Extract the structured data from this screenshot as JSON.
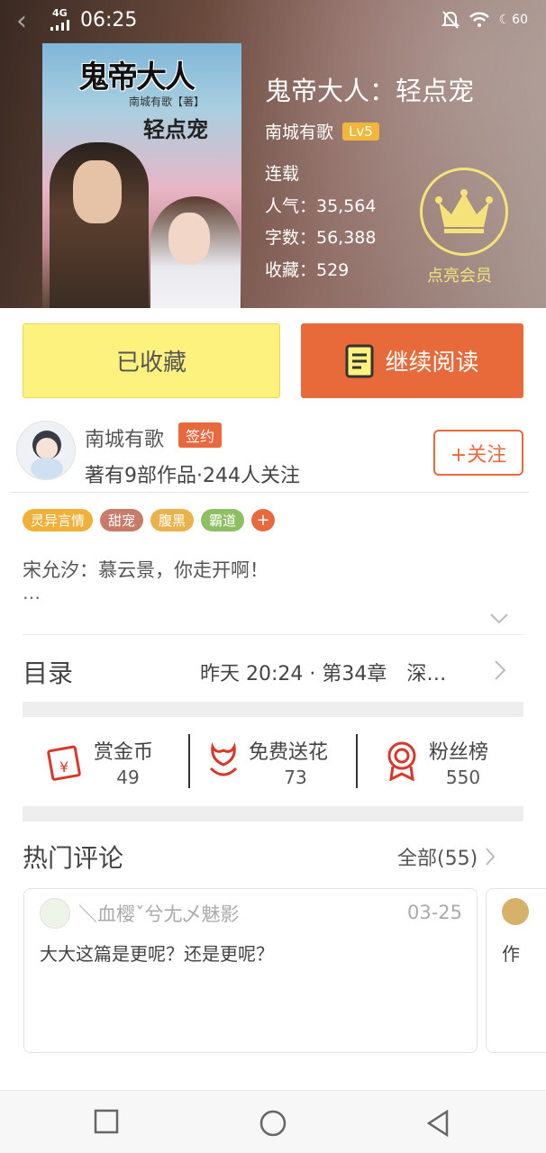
{
  "status_bar": {
    "network": "4G",
    "time": "06:25",
    "battery": "60"
  },
  "book": {
    "title": "鬼帝大人：轻点宠",
    "author": "南城有歌",
    "level": "Lv5",
    "status": "连载",
    "popularity": "人气：35,564",
    "word_count": "字数：56,388",
    "collections": "收藏：529",
    "vip_label": "点亮会员",
    "cover": {
      "title": "鬼帝大人",
      "author": "南城有歌【著】",
      "subtitle": "轻点宠"
    }
  },
  "actions": {
    "favorited_label": "已收藏",
    "continue_label": "继续阅读"
  },
  "author_card": {
    "name": "南城有歌",
    "badge": "签约",
    "stats": "著有9部作品·244人关注",
    "follow_label": "+关注"
  },
  "tags": [
    {
      "label": "灵异言情",
      "color": "#f0b03a"
    },
    {
      "label": "甜宠",
      "color": "#c97b6a"
    },
    {
      "label": "腹黑",
      "color": "#e8b34c"
    },
    {
      "label": "霸道",
      "color": "#8fbf63"
    }
  ],
  "tag_add": "+",
  "summary": {
    "text": "宋允汐：慕云景，你走开啊！",
    "more": "…"
  },
  "catalog": {
    "title": "目录",
    "update": "昨天 20:24 · 第34章　深…"
  },
  "stats": [
    {
      "label": "赏金币",
      "value": "49",
      "icon": "red-envelope-icon"
    },
    {
      "label": "免费送花",
      "value": "73",
      "icon": "flower-icon"
    },
    {
      "label": "粉丝榜",
      "value": "550",
      "icon": "medal-icon"
    }
  ],
  "comments": {
    "title": "热门评论",
    "all_label": "全部(55)",
    "items": [
      {
        "user": "＼血樱ˇ兮尢乄魅影",
        "date": "03-25",
        "text": "大大这篇是更呢？还是更呢？"
      },
      {
        "user": "",
        "date": "",
        "text": "作"
      }
    ]
  },
  "colors": {
    "accent": "#e8693e",
    "favorite_bg": "#fdf27d",
    "vip_gold": "#f6e27a"
  }
}
